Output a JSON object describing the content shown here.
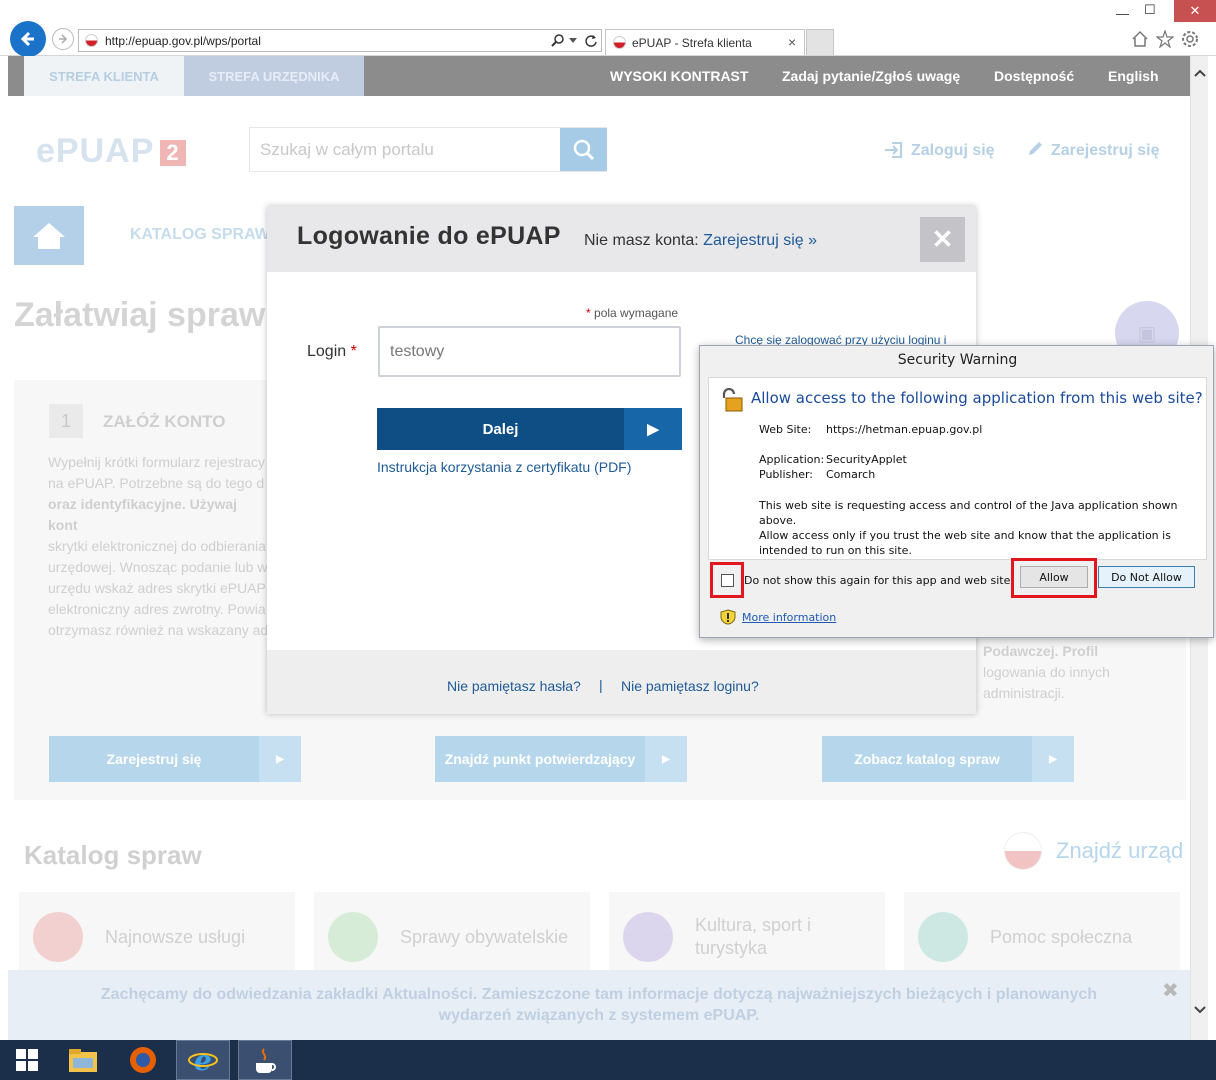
{
  "browser": {
    "url": "http://epuap.gov.pl/wps/portal",
    "tab_title": "ePUAP - Strefa klienta",
    "tab_close": "×",
    "win_minimize": "—",
    "win_maximize": "☐",
    "win_close": "✕"
  },
  "topnav": {
    "tab_klient": "STREFA KLIENTA",
    "tab_urzednik": "STREFA URZĘDNIKA",
    "links": [
      "WYSOKI KONTRAST",
      "Zadaj pytanie/Zgłoś uwagę",
      "Dostępność",
      "English"
    ]
  },
  "header": {
    "logo_text": "ePUAP",
    "logo_num": "2",
    "search_placeholder": "Szukaj w całym portalu",
    "login_link": "Zaloguj się",
    "register_link": "Zarejestruj się"
  },
  "main": {
    "katalog_tab": "KATALOG SPRAW",
    "heading": "Załatwiaj spraw",
    "step1": {
      "number": "1",
      "title": "ZAŁÓŻ KONTO",
      "text": [
        "Wypełnij krótki formularz rejestracy",
        "na ePUAP. Potrzebne są do tego d",
        "oraz identyfikacyjne. Używaj kont",
        "skrytki elektronicznej do odbierania",
        "urzędowej. Wnosząc podanie lub w",
        "urzędu wskaż adres skrytki ePUAP",
        "elektroniczny adres zwrotny. Powia",
        "otrzymasz również na wskazany ad"
      ]
    },
    "right_text": [
      "Podawczej. Profil",
      "logowania do innych",
      "administracji."
    ],
    "buttons": [
      "Zarejestruj się",
      "Znajdź punkt potwierdzający",
      "Zobacz katalog spraw"
    ],
    "arrow": "▶",
    "katalog_heading": "Katalog spraw",
    "znajdz_urzad": "Znajdź urząd",
    "categories": [
      "Najnowsze usługi",
      "Sprawy obywatelskie",
      "Kultura, sport i turystyka",
      "Pomoc społeczna"
    ],
    "banner_line1": "Zachęcamy do odwiedzania zakładki Aktualności. Zamieszczone tam informacje dotyczą najważniejszych bieżących i planowanych",
    "banner_line2": "wydarzeń związanych z systemem ePUAP.",
    "banner_close": "✖"
  },
  "login_modal": {
    "title": "Logowanie do ePUAP",
    "no_account": "Nie masz konta:",
    "register_link": "Zarejestruj się »",
    "close": "✕",
    "required_note": "pola wymagane",
    "required_star": "*",
    "login_label": "Login",
    "login_value": "testowy",
    "cert_link": "Chcę się zalogować przy użyciu loginu i",
    "submit": "Dalej",
    "submit_arrow": "▶",
    "instruction_link": "Instrukcja korzystania z certyfikatu (PDF)",
    "forgot_password": "Nie pamiętasz hasła?",
    "separator": "|",
    "forgot_login": "Nie pamiętasz loginu?"
  },
  "security_warning": {
    "title": "Security Warning",
    "heading": "Allow access to the following application from this web site?",
    "website_label": "Web Site:",
    "website_value": "https://hetman.epuap.gov.pl",
    "application_label": "Application:",
    "application_value": "SecurityApplet",
    "publisher_label": "Publisher:",
    "publisher_value": "Comarch",
    "message_lines": [
      "This web site is requesting access and control of the Java application shown above.",
      "Allow access only if you trust the web site and know that the application is",
      "intended to run on this site."
    ],
    "checkbox_label": "Do not show this again for this app and web site.",
    "allow": "Allow",
    "do_not_allow": "Do Not Allow",
    "more_info": "More information"
  },
  "colors": {
    "brand_blue": "#0e4e84",
    "link_blue": "#1e5a96",
    "highlight_red": "#e0171f"
  }
}
